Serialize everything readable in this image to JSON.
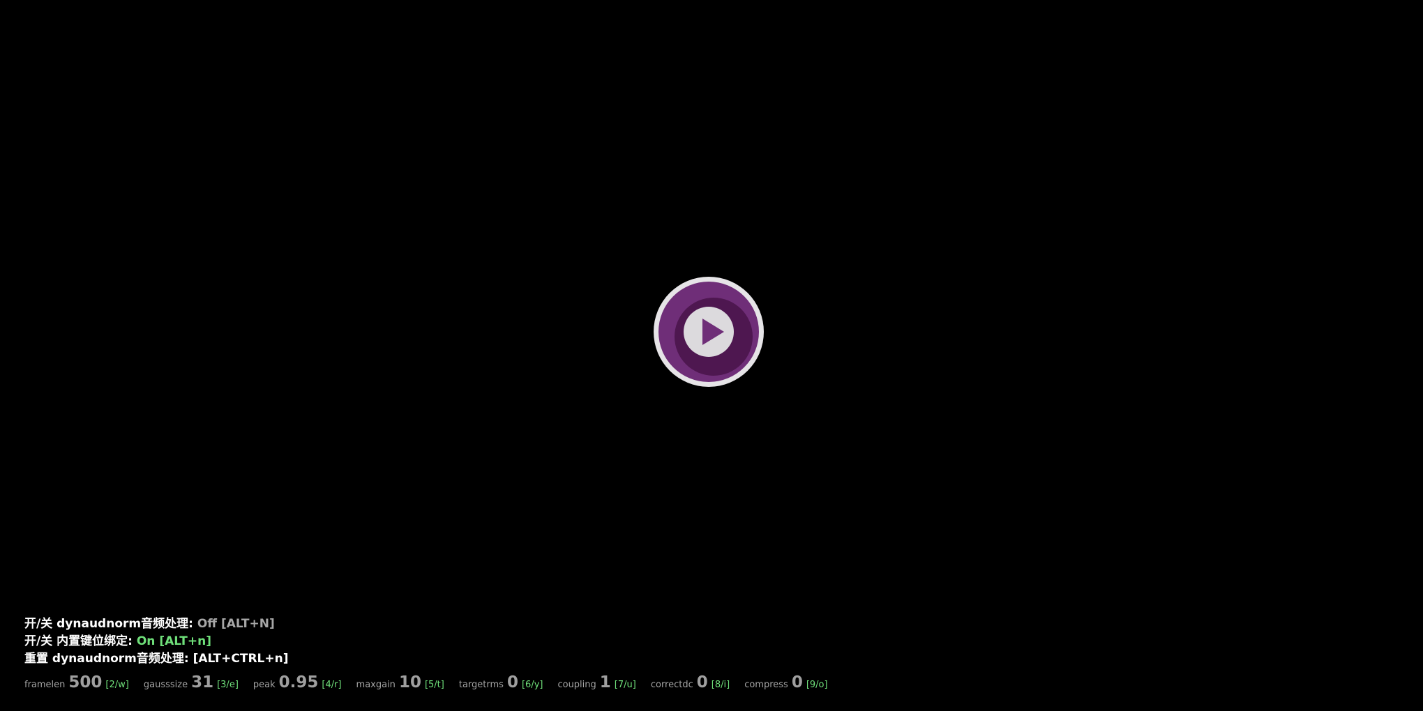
{
  "player": {
    "logo_icon": "mpv-play-logo-icon",
    "colors": {
      "background": "#000000",
      "logo_outer": "#e6e4e7",
      "logo_ring": "#6f2e78",
      "logo_inner": "#4e1750",
      "play_disc": "#dcdadd",
      "status_on": "#6fe07a",
      "status_off": "#a7a7a7"
    }
  },
  "osd": {
    "lines": [
      {
        "label": "开/关 dynaudnorm音频处理: ",
        "status": "Off [ALT+N]"
      },
      {
        "label": "开/关 内置键位绑定: ",
        "status": "On [ALT+n]"
      },
      {
        "label": "重置  dynaudnorm音频处理:  [ALT+CTRL+n]"
      }
    ],
    "params": [
      {
        "name": "framelen",
        "value": "500",
        "key": "[2/w]"
      },
      {
        "name": "gausssize",
        "value": "31",
        "key": "[3/e]"
      },
      {
        "name": "peak",
        "value": "0.95",
        "key": "[4/r]"
      },
      {
        "name": "maxgain",
        "value": "10",
        "key": "[5/t]"
      },
      {
        "name": "targetrms",
        "value": "0",
        "key": "[6/y]"
      },
      {
        "name": "coupling",
        "value": "1",
        "key": "[7/u]"
      },
      {
        "name": "correctdc",
        "value": "0",
        "key": "[8/i]"
      },
      {
        "name": "compress",
        "value": "0",
        "key": "[9/o]"
      }
    ]
  }
}
